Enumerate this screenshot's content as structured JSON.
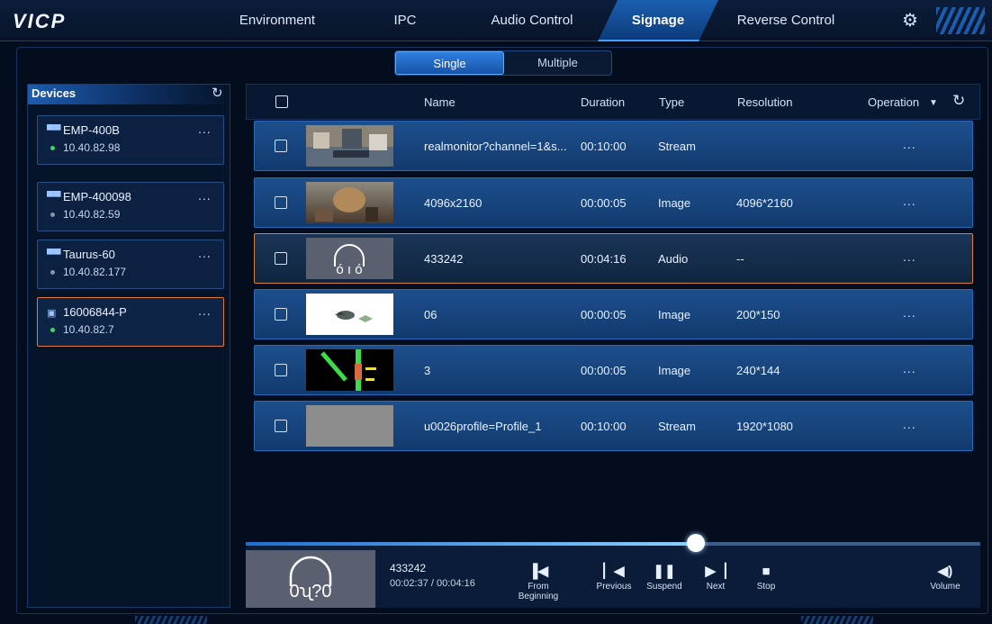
{
  "app": {
    "logo": "VICP"
  },
  "nav": {
    "tabs": [
      {
        "label": "Environment"
      },
      {
        "label": "IPC"
      },
      {
        "label": "Audio Control"
      },
      {
        "label": "Signage"
      },
      {
        "label": "Reverse Control"
      }
    ],
    "active": "Signage",
    "settings_icon": "gear-icon"
  },
  "mode": {
    "single": "Single",
    "multiple": "Multiple",
    "active": "Single"
  },
  "devices": {
    "title": "Devices",
    "items": [
      {
        "name": "EMP-400B",
        "ip": "10.40.82.98",
        "online": true,
        "status_color": "#3fd36b"
      },
      {
        "name": "EMP-400098",
        "ip": "10.40.82.59",
        "online": false,
        "status_color": "#8a96a8"
      },
      {
        "name": "Taurus-60",
        "ip": "10.40.82.177",
        "online": false,
        "status_color": "#8a96a8"
      },
      {
        "name": "16006844-P",
        "ip": "10.40.82.7",
        "online": true,
        "status_color": "#3fd36b",
        "selected": true
      }
    ],
    "more": "..."
  },
  "table": {
    "headers": {
      "name": "Name",
      "duration": "Duration",
      "type": "Type",
      "resolution": "Resolution",
      "operation": "Operation"
    },
    "rows": [
      {
        "name": "realmonitor?channel=1&s...",
        "duration": "00:10:00",
        "type": "Stream",
        "resolution": "",
        "more": "..."
      },
      {
        "name": "4096x2160",
        "duration": "00:00:05",
        "type": "Image",
        "resolution": "4096*2160",
        "more": "..."
      },
      {
        "name": "433242",
        "duration": "00:04:16",
        "type": "Audio",
        "resolution": "--",
        "more": "...",
        "selected": true
      },
      {
        "name": "06",
        "duration": "00:00:05",
        "type": "Image",
        "resolution": "200*150",
        "more": "..."
      },
      {
        "name": "3",
        "duration": "00:00:05",
        "type": "Image",
        "resolution": "240*144",
        "more": "..."
      },
      {
        "name": "u0026profile=Profile_1",
        "duration": "00:10:00",
        "type": "Stream",
        "resolution": "1920*1080",
        "more": "..."
      }
    ]
  },
  "player": {
    "title": "433242",
    "time": "00:02:37 / 00:04:16",
    "progress": 0.6133,
    "controls": {
      "from_beginning": "From Beginning",
      "previous": "Previous",
      "suspend": "Suspend",
      "next": "Next",
      "stop": "Stop",
      "volume": "Volume"
    }
  }
}
